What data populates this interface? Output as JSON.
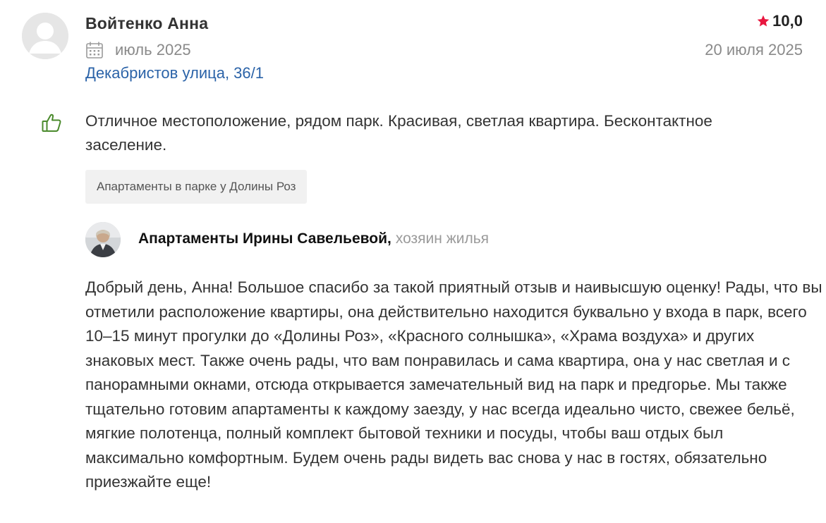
{
  "review": {
    "author_name": "Войтенко Анна",
    "stay_date": "июль 2025",
    "address": "Декабристов улица, 36/1",
    "rating": "10,0",
    "review_date": "20 июля 2025",
    "positive_text": "Отличное местоположение, рядом парк. Красивая, светлая квартира. Бесконтактное заселение.",
    "property_tag": "Апартаменты в парке у Долины Роз"
  },
  "host_reply": {
    "host_name": "Апартаменты Ирины Савельевой,",
    "host_role": "хозяин жилья",
    "text": "Добрый день, Анна! Большое спасибо за такой приятный отзыв и наивысшую оценку! Рады, что вы отметили расположение квартиры, она действительно находится буквально у входа в парк, всего 10–15 минут прогулки до «Долины Роз», «Красного солнышка», «Храма воздуха» и других знаковых мест. Также очень рады, что вам понравилась и сама квартира, она у нас светлая и с панорамными окнами, отсюда открывается замечательный вид на парк и предгорье. Мы также тщательно готовим апартаменты к каждому заезду, у нас всегда идеально чисто, свежее бельё, мягкие полотенца, полный комплект бытовой техники и посуды, чтобы ваш отдых был максимально комфортным. Будем очень рады видеть вас снова у нас в гостях, обязательно приезжайте еще!"
  },
  "icons": {
    "avatar": "user-placeholder-icon",
    "calendar": "calendar-icon",
    "star": "star-icon",
    "thumb": "thumbs-up-icon"
  },
  "colors": {
    "link": "#2b63a8",
    "star": "#e8173f",
    "thumb": "#4a8a2c",
    "muted": "#8a8a8a"
  }
}
